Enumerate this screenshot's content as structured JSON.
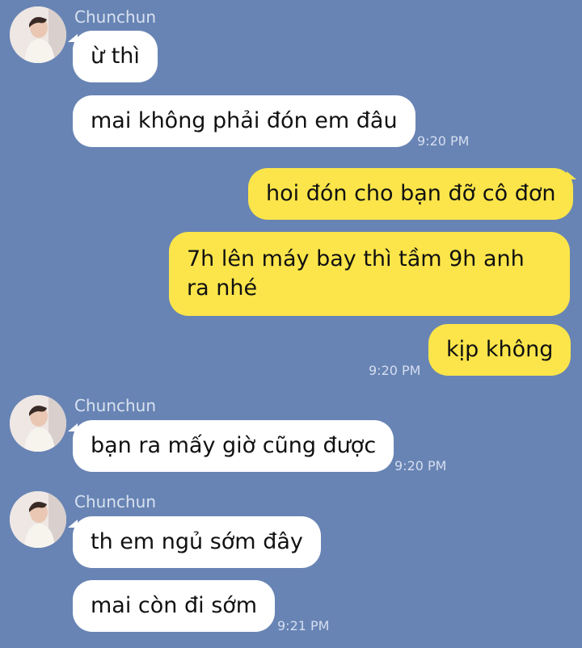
{
  "colors": {
    "background": "#6884b4",
    "incoming_bubble": "#ffffff",
    "outgoing_bubble": "#fbe54a",
    "meta_text": "#d5def0"
  },
  "messages": [
    {
      "sender": "Chunchun",
      "avatar": "user-avatar",
      "bubbles": [
        "ừ thì",
        "mai không phải đón em đâu"
      ],
      "time": "9:20 PM"
    },
    {
      "sender": "me",
      "bubbles": [
        "hoi đón cho bạn đỡ cô đơn",
        "7h lên máy bay thì tầm 9h anh ra nhé",
        "kịp không"
      ],
      "time": "9:20 PM"
    },
    {
      "sender": "Chunchun",
      "avatar": "user-avatar",
      "bubbles": [
        "bạn ra mấy giờ cũng được"
      ],
      "time": "9:20 PM"
    },
    {
      "sender": "Chunchun",
      "avatar": "user-avatar",
      "bubbles": [
        "th em ngủ sớm đây",
        "mai còn đi sớm"
      ],
      "time": "9:21 PM"
    }
  ]
}
